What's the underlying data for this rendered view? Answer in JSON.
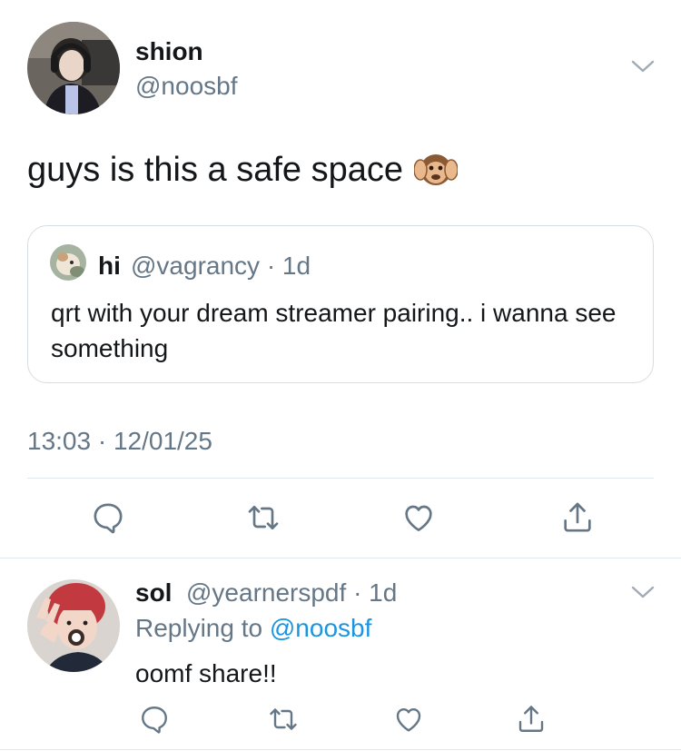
{
  "main_tweet": {
    "display_name": "shion",
    "handle": "@noosbf",
    "text": "guys is this a safe space",
    "emoji": "monkey-covering-ears",
    "timestamp": "13:03 · 12/01/25"
  },
  "quoted_tweet": {
    "display_name": "hi",
    "meta": "@vagrancy · 1d",
    "text": "qrt with your dream streamer pairing.. i wanna see something"
  },
  "reply_tweet": {
    "display_name": "sol",
    "meta": "@yearnerspdf · 1d",
    "replying_prefix": "Replying to",
    "replying_handle": "@noosbf",
    "text": "oomf share!!"
  },
  "actions": [
    "reply-icon",
    "retweet-icon",
    "like-icon",
    "share-icon"
  ],
  "colors": {
    "text_primary": "#14171a",
    "text_secondary": "#657786",
    "link": "#1b95e0",
    "divider": "#e1e8ed"
  }
}
